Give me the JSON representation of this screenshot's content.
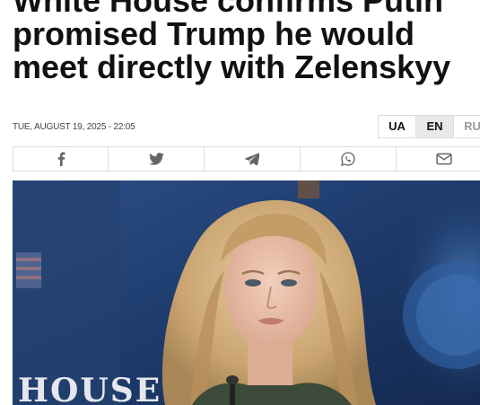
{
  "article": {
    "headline_lines": [
      "White House confirms Putin",
      "promised Trump he would",
      "meet directly with Zelenskyy"
    ],
    "date": "TUE, AUGUST 19, 2025 - 22:05"
  },
  "language_switch": [
    {
      "code": "UA",
      "active": false
    },
    {
      "code": "EN",
      "active": true
    },
    {
      "code": "RU",
      "active": false
    }
  ],
  "share_bar": {
    "icons": [
      "facebook-icon",
      "twitter-icon",
      "telegram-icon",
      "whatsapp-icon",
      "email-icon"
    ]
  },
  "photo": {
    "backdrop_text": "HOUSE",
    "colors": {
      "backdrop": "#1c3a66",
      "hair": "#d8b98c",
      "skin": "#e8c0a8",
      "clothing": "#3c4a3a"
    }
  }
}
